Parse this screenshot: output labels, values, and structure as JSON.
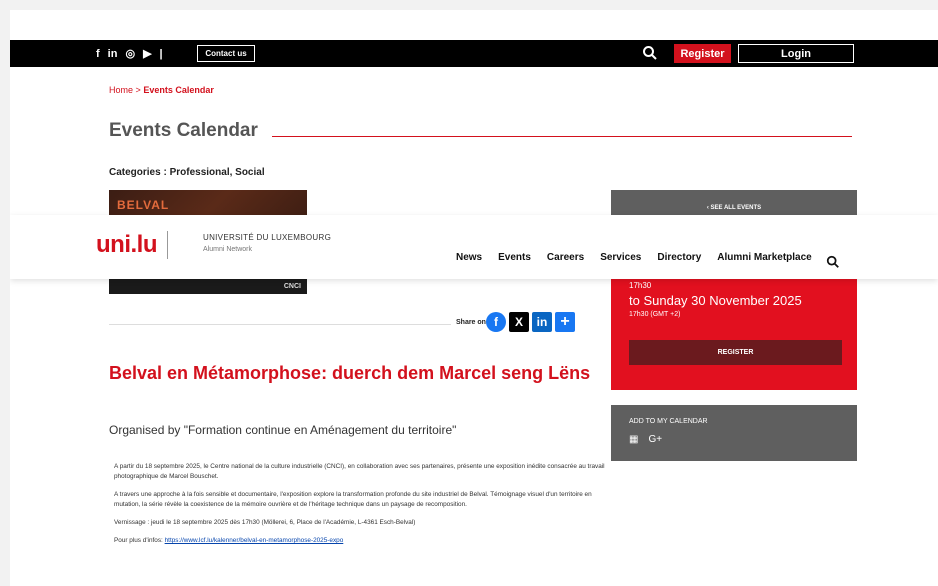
{
  "topbar": {
    "social": [
      "f",
      "in",
      "◎",
      "▶",
      "|"
    ],
    "contact_label": "Contact us",
    "register_label": "Register",
    "login_label": "Login"
  },
  "breadcrumb": {
    "home": "Home",
    "separator": ">",
    "current": "Events Calendar"
  },
  "page_title": "Events Calendar",
  "categories": "Categories : Professional, Social",
  "event_image": {
    "heading": "BELVAL",
    "logo": "CNCI"
  },
  "sidebar": {
    "see_all": "‹ SEE ALL EVENTS",
    "time_start": "17h30",
    "to_date": "to Sunday 30 November 2025",
    "time_end": "17h30 (GMT +2)",
    "register_label": "REGISTER",
    "add_to_calendar": "ADD TO MY CALENDAR",
    "cal_icons": [
      "▦",
      "G+"
    ]
  },
  "header": {
    "logo": "uni.lu",
    "university": "UNIVERSITÉ DU LUXEMBOURG",
    "network": "Alumni Network",
    "nav": [
      "News",
      "Events",
      "Careers",
      "Services",
      "Directory",
      "Alumni Marketplace"
    ]
  },
  "share": {
    "label": "Share on :",
    "icons": [
      "f",
      "X",
      "in",
      "+"
    ]
  },
  "event": {
    "title": "Belval en Métamorphose: duerch dem Marcel seng Lëns",
    "organised": "Organised by \"Formation continue en Aménagement du territoire\"",
    "paragraphs": [
      "A partir du 18 septembre 2025, le Centre national de la culture industrielle (CNCI), en collaboration avec ses partenaires, présente une exposition inédite consacrée au travail photographique de Marcel Bouschet.",
      "A travers une approche à la fois sensible et documentaire, l'exposition explore la transformation profonde du site industriel de Belval. Témoignage visuel d'un territoire en mutation, la série révèle la coexistence de la mémoire ouvrière et de l'héritage technique dans un paysage de recomposition.",
      "Vernissage : jeudi le 18 septembre 2025 dès 17h30 (Möllerei, 6, Place de l'Académie, L-4361 Esch-Belval)"
    ],
    "more_info_label": "Pour plus d'infos:",
    "more_info_link": "https://www.lcf.lu/kalenner/belval-en-metamorphose-2025-expo"
  }
}
